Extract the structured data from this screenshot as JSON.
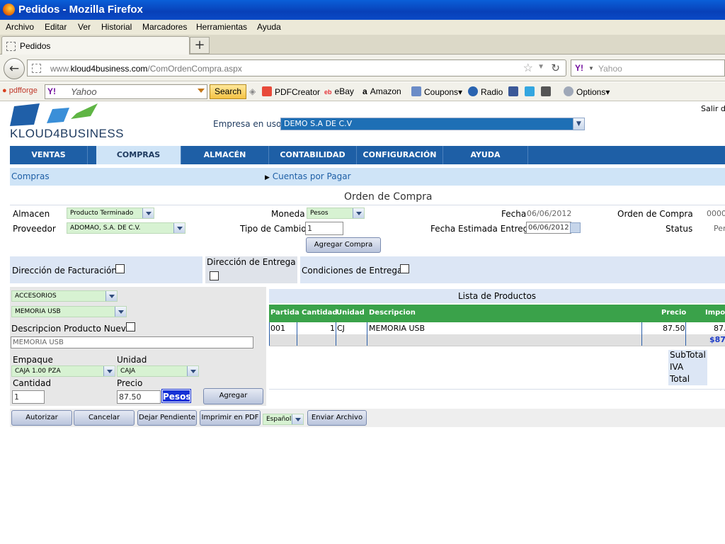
{
  "window": {
    "title": "Pedidos - Mozilla Firefox"
  },
  "menu": [
    "Archivo",
    "Editar",
    "Ver",
    "Historial",
    "Marcadores",
    "Herramientas",
    "Ayuda"
  ],
  "tab": {
    "label": "Pedidos",
    "new_tab": "+"
  },
  "navbar": {
    "url_prefix": "www.",
    "url_domain": "kloud4business.com",
    "url_path": "/ComOrdenCompra.aspx",
    "search_engine": "Y!",
    "search_placeholder": "Yahoo"
  },
  "pdfbar": {
    "brand": "pdfforge",
    "yahoo_logo": "Y!",
    "yahoo_placeholder": "Yahoo",
    "search_button": "Search",
    "items": [
      "PDFCreator",
      "eBay",
      "Amazon",
      "Coupons",
      "Radio",
      "Options"
    ]
  },
  "app": {
    "logo_text": "KLOUD4BUSINESS",
    "logout": "Salir d",
    "company_label": "Empresa en uso:",
    "company_value": "DEMO S.A DE C.V",
    "tabs": [
      "VENTAS",
      "COMPRAS",
      "ALMACÉN",
      "CONTABILIDAD",
      "CONFIGURACIÓN",
      "AYUDA"
    ],
    "active_tab": "COMPRAS",
    "breadcrumb": "Compras",
    "subnav": "Cuentas por Pagar",
    "form_title": "Orden de Compra"
  },
  "form": {
    "almacen_label": "Almacen",
    "almacen_value": "Producto Terminado",
    "proveedor_label": "Proveedor",
    "proveedor_value": "ADOMAO, S.A. DE C.V.",
    "moneda_label": "Moneda",
    "moneda_value": "Pesos",
    "tipo_cambio_label": "Tipo de Cambio",
    "tipo_cambio_value": "1",
    "agregar_compra": "Agregar Compra",
    "fecha_label": "Fecha",
    "fecha_value": "06/06/2012",
    "fecha_estimada_label": "Fecha Estimada Entrega",
    "fecha_estimada_value": "06/06/2012",
    "orden_label": "Orden de Compra",
    "orden_value": "0000",
    "status_label": "Status",
    "status_value": "Per",
    "direccion_facturacion": "Dirección de Facturación",
    "direccion_entrega": "Dirección de Entrega",
    "condiciones_entrega": "Condiciones de Entrega"
  },
  "product_form": {
    "categoria": "ACCESORIOS",
    "producto": "MEMORIA USB",
    "descripcion_nuevo_label": "Descripcion Producto Nuevo",
    "descripcion_value": "MEMORIA USB",
    "empaque_label": "Empaque",
    "empaque_value": "CAJA 1.00 PZA",
    "unidad_label": "Unidad",
    "unidad_value": "CAJA",
    "cantidad_label": "Cantidad",
    "cantidad_value": "1",
    "precio_label": "Precio",
    "precio_value": "87.50",
    "moneda_badge": "Pesos",
    "agregar": "Agregar"
  },
  "product_list": {
    "title": "Lista de Productos",
    "columns": [
      "Partida",
      "Cantidad",
      "Unidad",
      "Descripcion",
      "Precio",
      "Impo"
    ],
    "rows": [
      {
        "partida": "001",
        "cantidad": "1",
        "unidad": "CJ",
        "descripcion": "MEMORIA USB",
        "precio": "87.50",
        "importe": "87."
      }
    ],
    "total_row": "$87.",
    "summary": [
      "SubTotal",
      "IVA",
      "Total"
    ]
  },
  "actions": {
    "autorizar": "Autorizar",
    "cancelar": "Cancelar",
    "dejar_pendiente": "Dejar Pendiente",
    "imprimir_pdf": "Imprimir en PDF",
    "idioma": "Español",
    "enviar_archivo": "Enviar Archivo"
  },
  "colors": {
    "nav_blue": "#1e5fa6",
    "light_blue": "#cfe4f7",
    "green_header": "#3aa24a",
    "field_green": "#d7f2d2",
    "company_select": "#1e6fb5"
  }
}
